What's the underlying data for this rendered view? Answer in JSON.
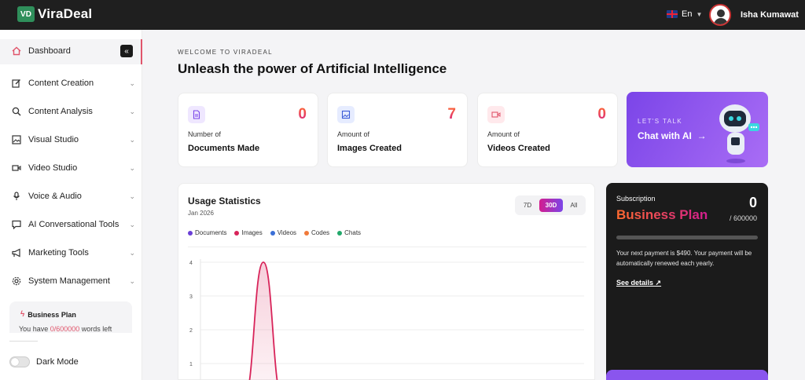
{
  "app": {
    "logo_badge": "VD",
    "logo_text": "ViraDeal"
  },
  "header": {
    "language": "En",
    "user_name": "Isha Kumawat"
  },
  "sidebar": {
    "items": [
      {
        "label": "Dashboard",
        "icon": "home-icon"
      },
      {
        "label": "Content Creation",
        "icon": "edit-icon"
      },
      {
        "label": "Content Analysis",
        "icon": "search-icon"
      },
      {
        "label": "Visual Studio",
        "icon": "image-icon"
      },
      {
        "label": "Video Studio",
        "icon": "video-icon"
      },
      {
        "label": "Voice & Audio",
        "icon": "microphone-icon"
      },
      {
        "label": "AI Conversational Tools",
        "icon": "chat-icon"
      },
      {
        "label": "Marketing Tools",
        "icon": "megaphone-icon"
      },
      {
        "label": "System Management",
        "icon": "gear-icon"
      }
    ],
    "plan": {
      "title": "Business Plan",
      "words_prefix": "You have ",
      "words_value": "0/600000",
      "words_suffix": " words left"
    },
    "dark_mode_label": "Dark Mode"
  },
  "main": {
    "welcome": "WELCOME TO VIRADEAL",
    "headline": "Unleash the power of Artificial Intelligence",
    "cards": [
      {
        "sub": "Number of",
        "title": "Documents Made",
        "value": "0",
        "icon": "document-icon",
        "icon_color": "#7b45e8",
        "icon_bg": "#efe7ff"
      },
      {
        "sub": "Amount of",
        "title": "Images Created",
        "value": "7",
        "icon": "image-icon",
        "icon_color": "#3b5bd6",
        "icon_bg": "#e6ecff"
      },
      {
        "sub": "Amount of",
        "title": "Videos Created",
        "value": "0",
        "icon": "video-icon",
        "icon_color": "#e0556b",
        "icon_bg": "#ffe9ec"
      }
    ],
    "promo": {
      "kicker": "LET'S TALK",
      "cta": "Chat with AI"
    }
  },
  "usage": {
    "title": "Usage Statistics",
    "date": "Jan 2026",
    "ranges": [
      "7D",
      "30D",
      "All"
    ],
    "active_range": "30D"
  },
  "chart_data": {
    "type": "area",
    "series": [
      {
        "name": "Documents",
        "color": "#6a3fd6",
        "values": []
      },
      {
        "name": "Images",
        "color": "#d8245a",
        "values": [
          0,
          4,
          0
        ]
      },
      {
        "name": "Videos",
        "color": "#3b6fd6",
        "values": []
      },
      {
        "name": "Codes",
        "color": "#f07a3a",
        "values": []
      },
      {
        "name": "Chats",
        "color": "#22a86b",
        "values": []
      }
    ],
    "y_ticks": [
      "4",
      "3",
      "2",
      "1"
    ],
    "ylim": [
      0,
      4
    ],
    "grid": true
  },
  "subscription": {
    "label": "Subscription",
    "plan": "Business Plan",
    "used": "0",
    "total": "/ 600000",
    "used_fraction": 0,
    "note": "Your next payment is $490. Your payment will be automatically renewed each yearly.",
    "link": "See details ↗"
  }
}
